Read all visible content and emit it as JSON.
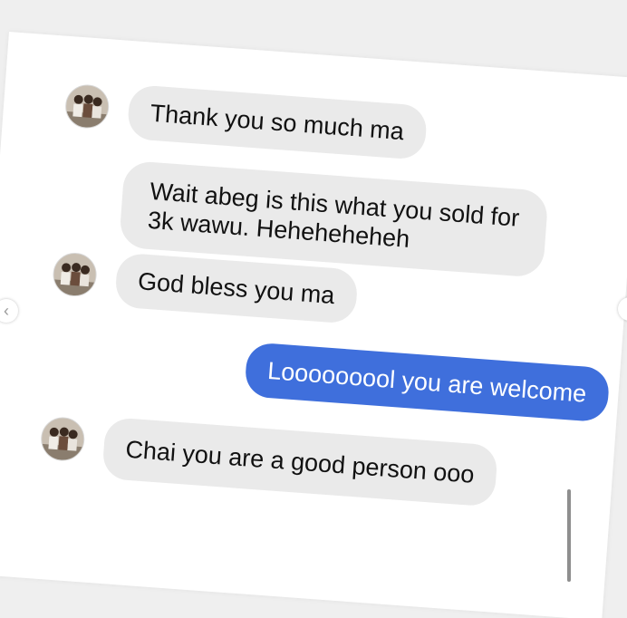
{
  "conversation": {
    "messages": [
      {
        "text": "Thank you so much ma",
        "direction": "received",
        "avatar": "group-photo-avatar"
      },
      {
        "lines": [
          "Wait abeg is this what you sold for",
          "3k wawu. Heheheheheh"
        ],
        "direction": "received"
      },
      {
        "text": "God bless you ma",
        "direction": "received",
        "avatar": "group-photo-avatar"
      },
      {
        "text": "Looooooool you are welcome",
        "direction": "sent"
      },
      {
        "text": "Chai you are a good person ooo",
        "direction": "received",
        "avatar": "group-photo-avatar"
      }
    ]
  },
  "navigation": {
    "prev_icon": "chevron-left-icon",
    "prev_glyph": "‹",
    "next_icon": "chevron-right-icon"
  },
  "colors": {
    "sent_bubble": "#3f6fdc",
    "received_bubble": "#eaeaea",
    "background": "#ffffff"
  }
}
